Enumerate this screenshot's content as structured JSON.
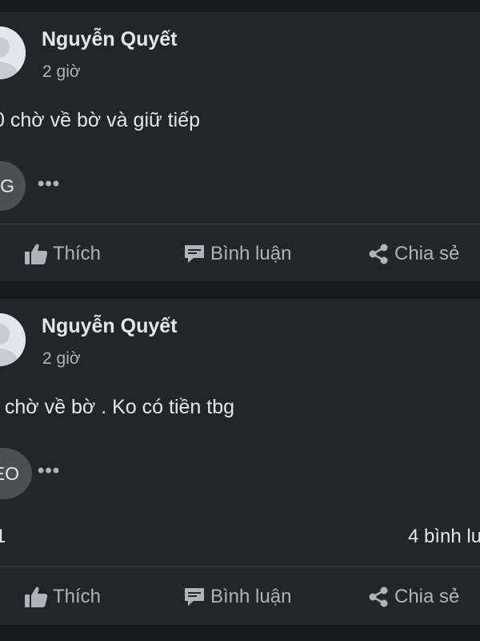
{
  "posts": [
    {
      "author": "Nguyễn Quyết",
      "time": "2 giờ",
      "text": "0 chờ về bờ và giữ tiếp",
      "chip_label": "G",
      "more_label": "•••",
      "actions": {
        "like": "Thích",
        "comment": "Bình luận",
        "share": "Chia sẻ"
      }
    },
    {
      "author": "Nguyễn Quyết",
      "time": "2 giờ",
      "text": ", chờ về bờ . Ko có tiền tbg",
      "chip_label": "EO",
      "more_label": "•••",
      "stats": {
        "reactions": "1",
        "comments": "4 bình lu"
      },
      "actions": {
        "like": "Thích",
        "comment": "Bình luận",
        "share": "Chia sẻ"
      }
    }
  ],
  "icons": {
    "like": "thumbs-up-icon",
    "comment": "comment-bubble-icon",
    "share": "share-icon",
    "more": "more-dots-icon",
    "avatar": "default-avatar-icon"
  },
  "colors": {
    "background": "#18191a",
    "card": "#242526",
    "primary_text": "#e4e6eb",
    "secondary_text": "#b0b3b8",
    "divider": "#3e4042",
    "chip": "#4e4f50"
  }
}
